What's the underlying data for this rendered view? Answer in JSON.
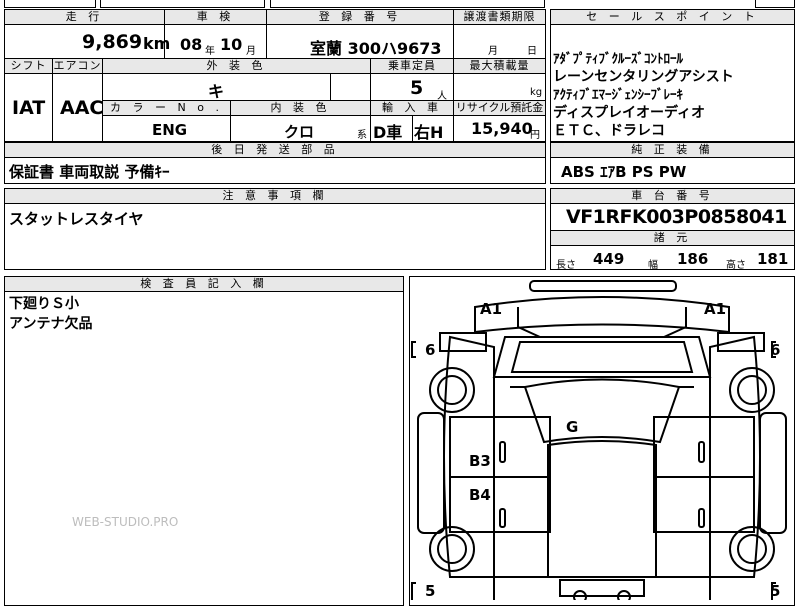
{
  "headers": {
    "mileage": "走 行",
    "inspection": "車 検",
    "registration": "登 録 番 号",
    "transfer_deadline": "譲渡書類期限",
    "sales_points": "セ ー ル ス ポ イ ン ト",
    "shift": "シフト",
    "aircon": "エアコン",
    "exterior_color": "外 装 色",
    "capacity": "乗車定員",
    "max_load": "最大積載量",
    "color_no": "カ ラ ー N o .",
    "interior_color": "内 装 色",
    "import": "輸 入 車",
    "recycle": "リサイクル預託金",
    "later_parts": "後 日 発 送 部 品",
    "genuine_equipment": "純 正 装 備",
    "notes": "注 意 事 項 欄",
    "chassis_no": "車 台 番 号",
    "dimensions": "諸 元",
    "inspector_notes": "検 査 員 記 入 欄"
  },
  "values": {
    "mileage_value": "9,869",
    "mileage_unit": "km",
    "inspection_year": "08",
    "inspection_year_unit": "年",
    "inspection_month": "10",
    "inspection_month_unit": "月",
    "registration_value": "室蘭 300ハ9673",
    "transfer_month_unit": "月",
    "transfer_day_unit": "日",
    "shift_value": "IAT",
    "aircon_value": "AAC",
    "exterior_color_value": "キ",
    "capacity_value": "5",
    "capacity_unit": "人",
    "max_load_unit": "kg",
    "color_no_value": "ENG",
    "interior_color_value": "クロ",
    "interior_suffix": "系",
    "import_value": "D車",
    "steering_value": "右H",
    "recycle_value": "15,940",
    "recycle_unit": "円",
    "chassis_no_value": "VF1RFK003P0858041",
    "length_label": "長さ",
    "length_value": "449",
    "width_label": "幅",
    "width_value": "186",
    "height_label": "高さ",
    "height_value": "181"
  },
  "sales_points": [
    "ｱﾀﾞﾌﾟﾃｨﾌﾞｸﾙｰｽﾞｺﾝﾄﾛｰﾙ",
    "レーンセンタリングアシスト",
    "ｱｸﾃｨﾌﾞｴﾏｰｼﾞｪﾝｼｰﾌﾞﾚｰｷ",
    "ディスプレイオーディオ",
    "ＥＴＣ、ドラレコ"
  ],
  "later_parts_value": "保証書  車両取説  予備ｷｰ",
  "genuine_equipment_value": "ABS  ｴｱB  PS  PW",
  "notes_value": "スタットレスタイヤ",
  "inspector_lines": [
    "下廻りＳ小",
    "アンテナ欠品"
  ],
  "diagram_marks": {
    "front_left": "A1",
    "front_right": "A1",
    "left_wheel_top": "6",
    "right_wheel_top": "6",
    "windshield": "G",
    "door_front": "B3",
    "door_rear": "B4",
    "left_wheel_bottom": "5",
    "right_wheel_bottom": "5"
  },
  "watermark": "WEB-STUDIO.PRO"
}
